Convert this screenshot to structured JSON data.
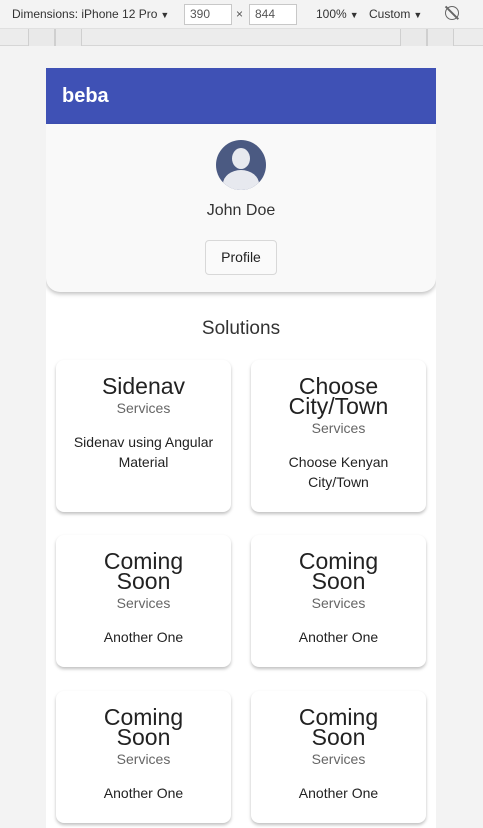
{
  "devtools": {
    "device_label": "Dimensions: iPhone 12 Pro",
    "width_value": "390",
    "height_value": "844",
    "times_symbol": "×",
    "zoom_label": "100%",
    "throttle_label": "Custom"
  },
  "app": {
    "title": "beba"
  },
  "profile": {
    "name": "John Doe",
    "button_label": "Profile"
  },
  "solutions": {
    "heading": "Solutions",
    "cards": [
      {
        "title_lines": [
          "Sidenav"
        ],
        "subtitle": "Services",
        "description_lines": [
          "Sidenav using Angular",
          "Material"
        ],
        "color": "#add8e6"
      },
      {
        "title_lines": [
          "Choose",
          "City/Town"
        ],
        "subtitle": "Services",
        "description_lines": [
          "Choose Kenyan",
          "City/Town"
        ],
        "color": "#90ee90"
      },
      {
        "title_lines": [
          "Coming",
          "Soon"
        ],
        "subtitle": "Services",
        "description_lines": [
          "Another One"
        ],
        "color": "#dcbdf0"
      },
      {
        "title_lines": [
          "Coming",
          "Soon"
        ],
        "subtitle": "Services",
        "description_lines": [
          "Another One"
        ],
        "color": "#add8e6"
      },
      {
        "title_lines": [
          "Coming",
          "Soon"
        ],
        "subtitle": "Services",
        "description_lines": [
          "Another One"
        ],
        "color": "#90ee90"
      },
      {
        "title_lines": [
          "Coming",
          "Soon"
        ],
        "subtitle": "Services",
        "description_lines": [
          "Another One"
        ],
        "color": "#dcbdf0"
      }
    ]
  }
}
